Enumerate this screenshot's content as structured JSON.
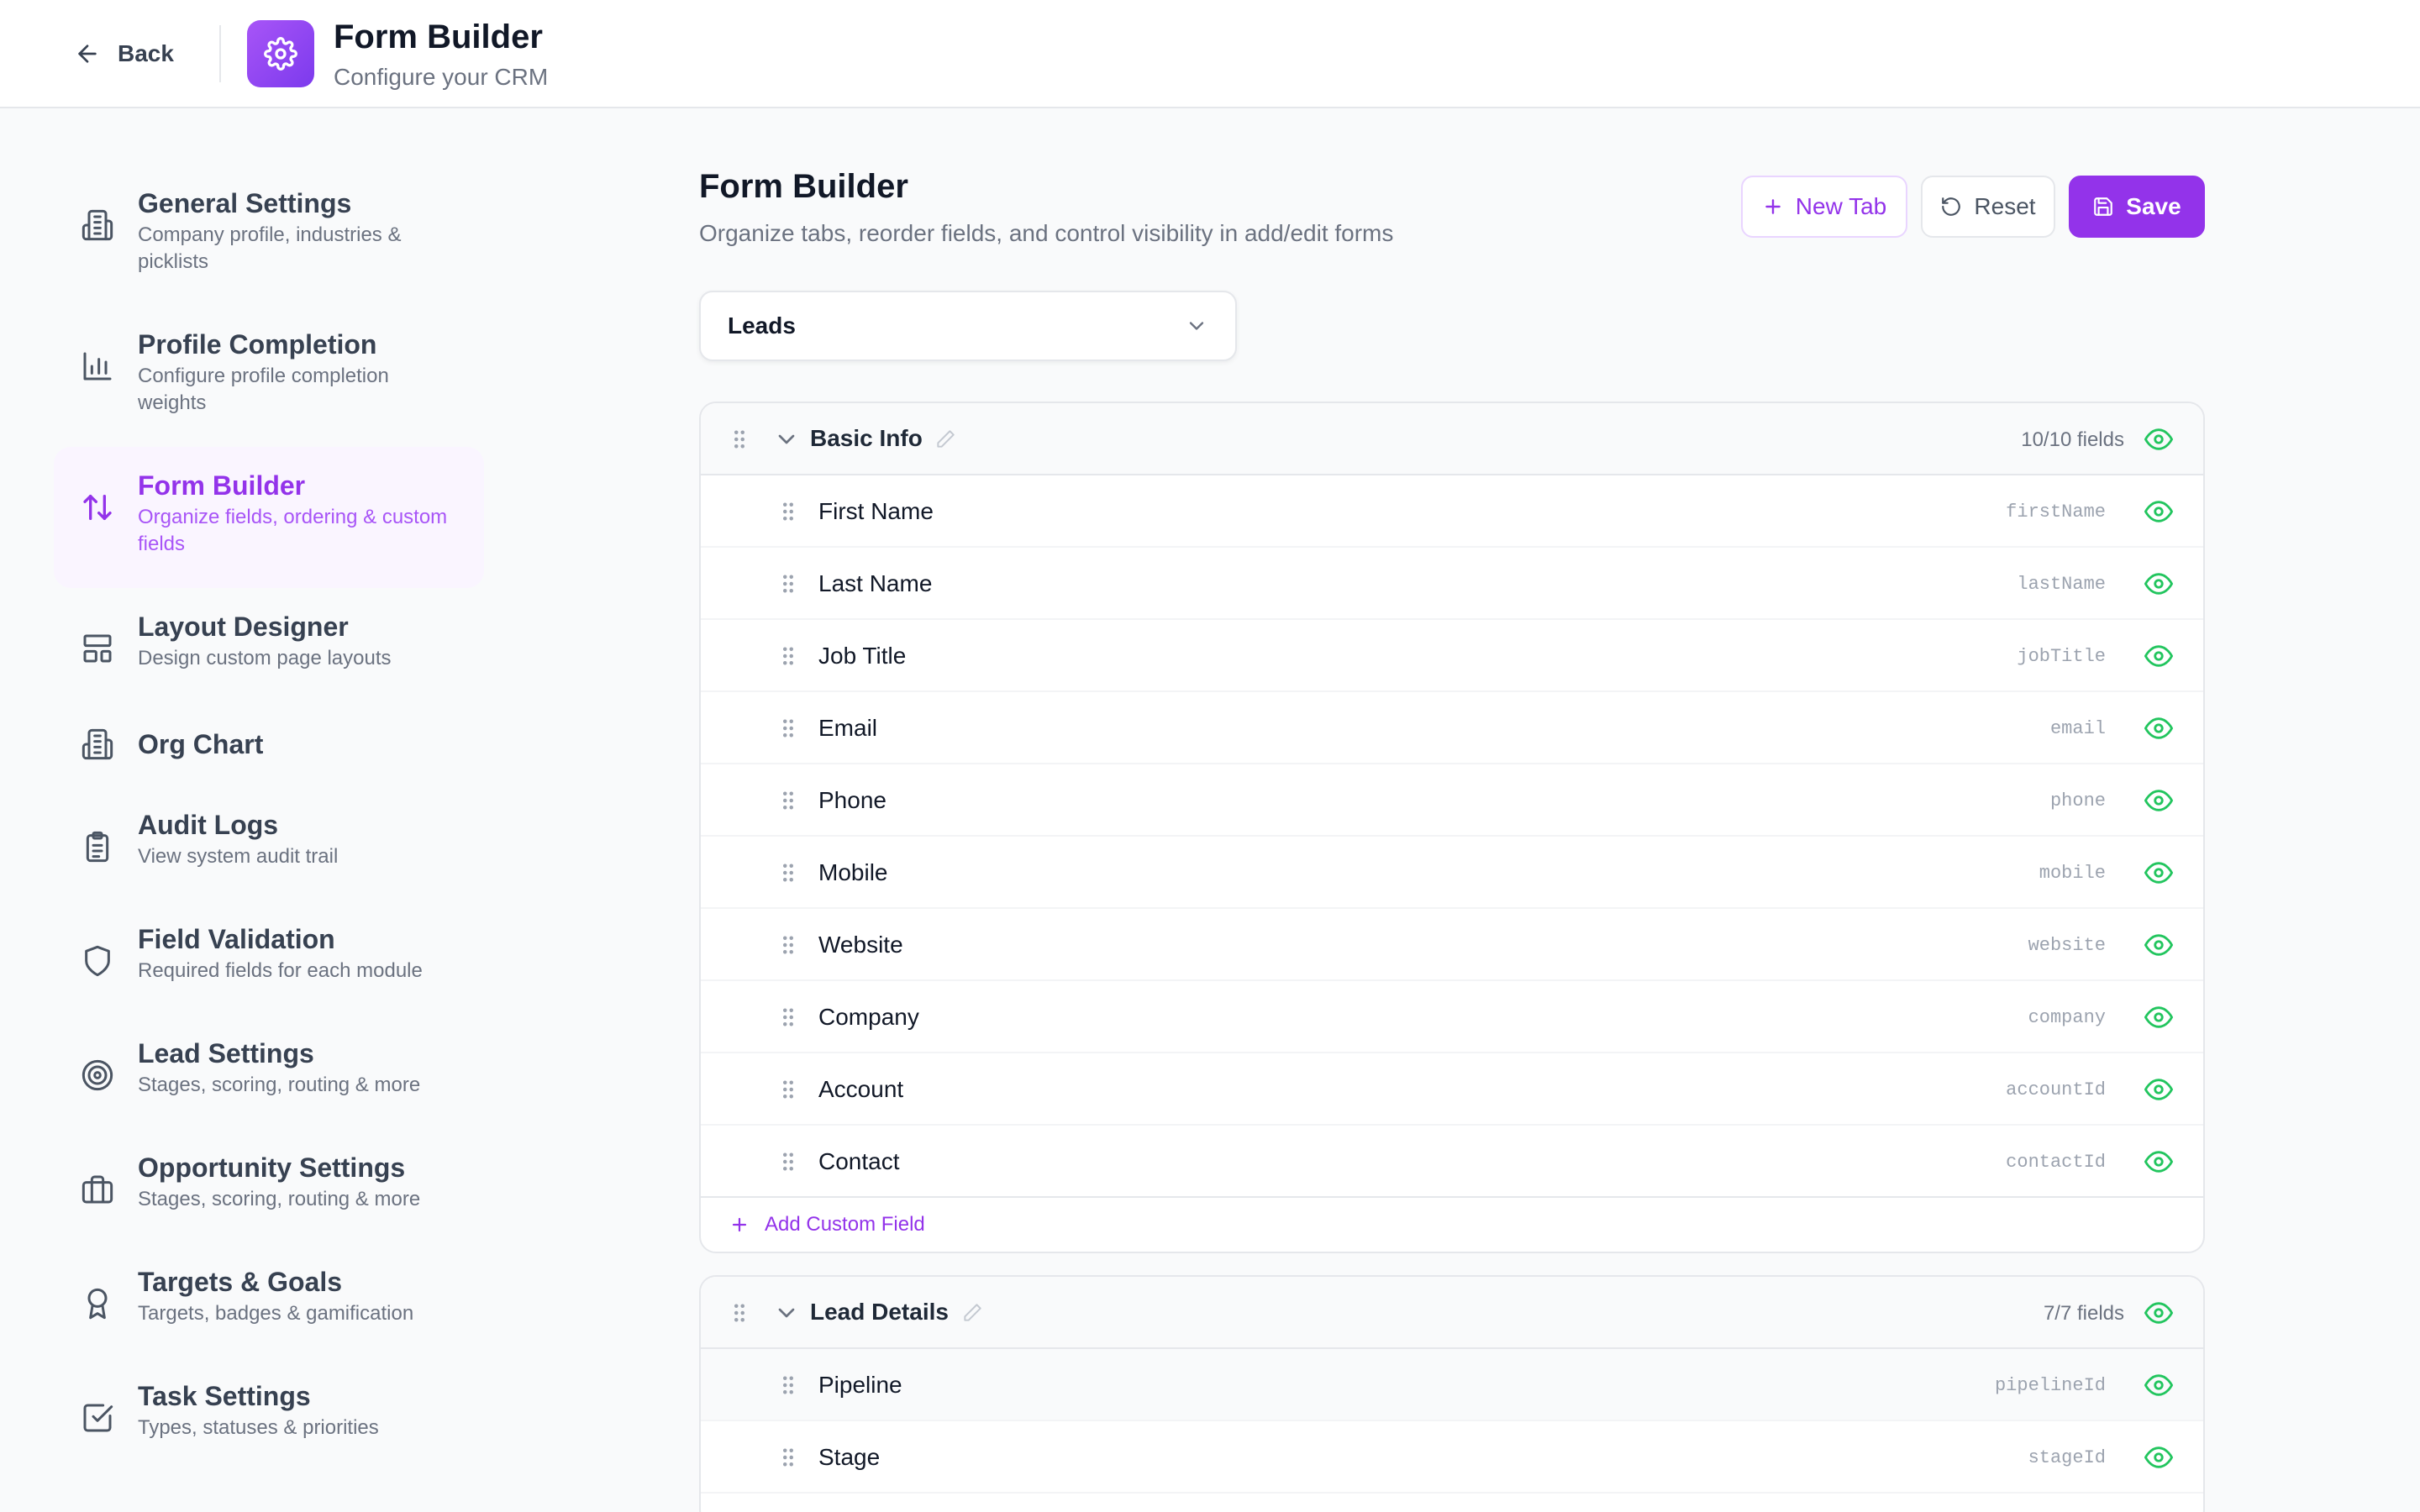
{
  "header": {
    "back_label": "Back",
    "title": "Form Builder",
    "subtitle": "Configure your CRM"
  },
  "sidebar": {
    "items": [
      {
        "title": "General Settings",
        "desc": "Company profile, industries & picklists",
        "icon": "building-icon"
      },
      {
        "title": "Profile Completion",
        "desc": "Configure profile completion weights",
        "icon": "bar-chart-icon"
      },
      {
        "title": "Form Builder",
        "desc": "Organize fields, ordering & custom fields",
        "icon": "arrows-up-down-icon",
        "active": true
      },
      {
        "title": "Layout Designer",
        "desc": "Design custom page layouts",
        "icon": "layout-icon"
      },
      {
        "title": "Org Chart",
        "desc": "",
        "icon": "building-icon"
      },
      {
        "title": "Audit Logs",
        "desc": "View system audit trail",
        "icon": "clipboard-list-icon"
      },
      {
        "title": "Field Validation",
        "desc": "Required fields for each module",
        "icon": "shield-icon"
      },
      {
        "title": "Lead Settings",
        "desc": "Stages, scoring, routing & more",
        "icon": "target-icon"
      },
      {
        "title": "Opportunity Settings",
        "desc": "Stages, scoring, routing & more",
        "icon": "briefcase-icon"
      },
      {
        "title": "Targets & Goals",
        "desc": "Targets, badges & gamification",
        "icon": "award-icon"
      },
      {
        "title": "Task Settings",
        "desc": "Types, statuses & priorities",
        "icon": "check-square-icon"
      }
    ]
  },
  "main": {
    "title": "Form Builder",
    "subtitle": "Organize tabs, reorder fields, and control visibility in add/edit forms",
    "new_tab_label": "New Tab",
    "reset_label": "Reset",
    "save_label": "Save",
    "module_select": "Leads",
    "sections": [
      {
        "title": "Basic Info",
        "count": "10/10 fields",
        "fields": [
          {
            "label": "First Name",
            "key": "firstName"
          },
          {
            "label": "Last Name",
            "key": "lastName"
          },
          {
            "label": "Job Title",
            "key": "jobTitle"
          },
          {
            "label": "Email",
            "key": "email"
          },
          {
            "label": "Phone",
            "key": "phone"
          },
          {
            "label": "Mobile",
            "key": "mobile"
          },
          {
            "label": "Website",
            "key": "website"
          },
          {
            "label": "Company",
            "key": "company"
          },
          {
            "label": "Account",
            "key": "accountId"
          },
          {
            "label": "Contact",
            "key": "contactId"
          }
        ],
        "add_label": "Add Custom Field"
      },
      {
        "title": "Lead Details",
        "count": "7/7 fields",
        "fields": [
          {
            "label": "Pipeline",
            "key": "pipelineId"
          },
          {
            "label": "Stage",
            "key": "stageId"
          }
        ]
      }
    ]
  },
  "colors": {
    "accent": "#9333ea",
    "visible_eye": "#22c55e"
  }
}
